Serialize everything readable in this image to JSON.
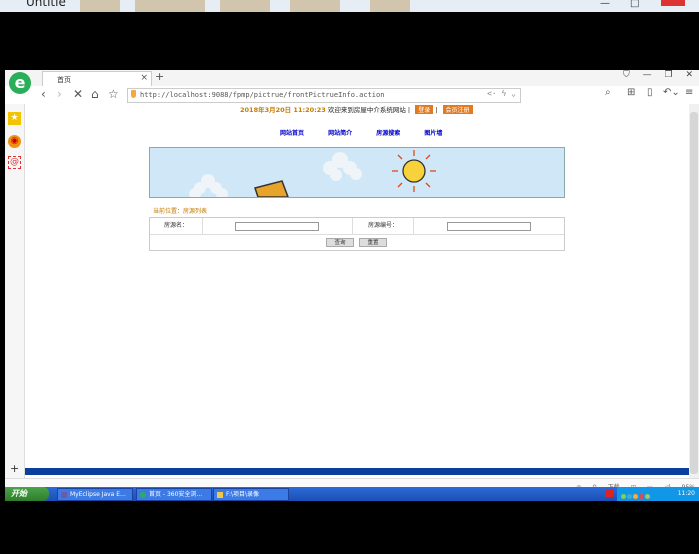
{
  "window": {
    "title": "Untitle"
  },
  "browser": {
    "logo": "e",
    "tab_title": "首页",
    "url": "http://localhost:9088/fpmp/pictrue/frontPictrueInfo.action",
    "status_items": [
      "下载",
      "95%"
    ]
  },
  "page": {
    "date": "2018年3月20日 11:20:23",
    "welcome": "欢迎来到房屋中介系统网站",
    "login_label": "登录",
    "register_label": "会员注册",
    "menu": [
      "网站首页",
      "网站简介",
      "房源搜索",
      "图片墙"
    ],
    "breadcrumb": "当前位置：房源列表",
    "search": {
      "field1_label": "房源名：",
      "field2_label": "房源编号：",
      "query_button": "查询",
      "reset_button": "重置"
    }
  },
  "taskbar": {
    "start_label": "开始",
    "items": [
      "MyEclipse Java E...",
      "首页 - 360安全浏...",
      "F:\\项目\\录像"
    ],
    "time": "11:20"
  },
  "colors": {
    "accent_orange": "#e27a1f",
    "menu_blue": "#0000cc",
    "logo_green": "#2aae5a",
    "taskbar_blue": "#1c4fb4"
  }
}
